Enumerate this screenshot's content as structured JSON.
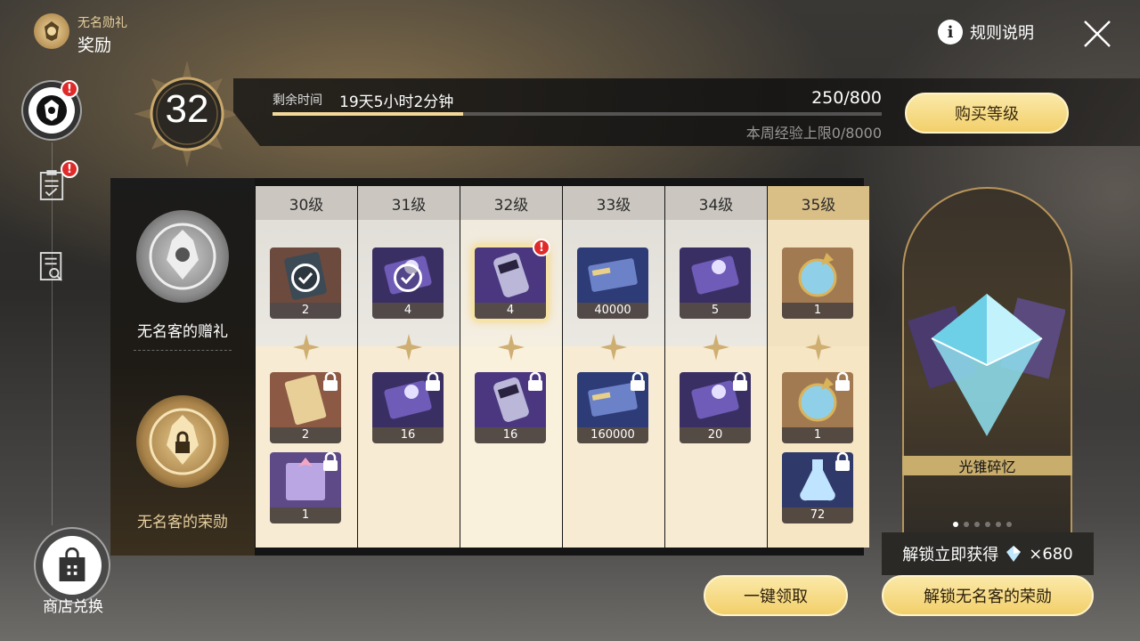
{
  "header": {
    "subtitle": "无名勋礼",
    "title": "奖励",
    "rules_label": "规则说明"
  },
  "nav": {
    "shop_label": "商店兑换",
    "badge_text": "!"
  },
  "progress": {
    "level": "32",
    "time_label": "剩余时间",
    "time_value": "19天5小时2分钟",
    "exp_value": "250/800",
    "exp_fraction": 0.3125,
    "weekly_cap": "本周经验上限0/8000",
    "buy_label": "购买等级"
  },
  "tiers": {
    "free_label": "无名客的赠礼",
    "premium_label": "无名客的荣勋"
  },
  "columns": [
    {
      "level": "30级",
      "state": "claimed",
      "free": [
        {
          "qty": "2",
          "art": "ticket-dark",
          "claimed": true
        }
      ],
      "premium": [
        {
          "qty": "2",
          "art": "ticket-gold",
          "locked": true
        },
        {
          "qty": "1",
          "art": "gift-purple",
          "locked": true
        }
      ]
    },
    {
      "level": "31级",
      "state": "claimed",
      "free": [
        {
          "qty": "4",
          "art": "chip-purple",
          "claimed": true
        }
      ],
      "premium": [
        {
          "qty": "16",
          "art": "chip-purple",
          "locked": true
        }
      ]
    },
    {
      "level": "32级",
      "state": "current",
      "free": [
        {
          "qty": "4",
          "art": "canister-purple",
          "highlight": true,
          "alert": true
        }
      ],
      "premium": [
        {
          "qty": "16",
          "art": "canister-purple",
          "locked": true
        }
      ]
    },
    {
      "level": "33级",
      "state": "locked",
      "free": [
        {
          "qty": "40000",
          "art": "credit-blue"
        }
      ],
      "premium": [
        {
          "qty": "160000",
          "art": "credit-blue",
          "locked": true
        }
      ]
    },
    {
      "level": "34级",
      "state": "locked",
      "free": [
        {
          "qty": "5",
          "art": "chip-purple"
        }
      ],
      "premium": [
        {
          "qty": "20",
          "art": "chip-purple",
          "locked": true
        }
      ]
    },
    {
      "level": "35级",
      "state": "upcoming",
      "free": [
        {
          "qty": "1",
          "art": "orb-gold"
        }
      ],
      "premium": [
        {
          "qty": "1",
          "art": "orb-gold",
          "locked": true
        },
        {
          "qty": "72",
          "art": "flask-blue",
          "locked": true
        }
      ]
    }
  ],
  "showcase": {
    "label": "光锥碎忆",
    "pages": 6,
    "active_page": 0
  },
  "unlock": {
    "tip_text": "解锁立即获得",
    "tip_amount": "×680",
    "button_label": "解锁无名客的荣勋"
  },
  "claim": {
    "button_label": "一键领取"
  },
  "colors": {
    "accent_gold": "#f2cf6a",
    "badge_red": "#e02a2a"
  }
}
